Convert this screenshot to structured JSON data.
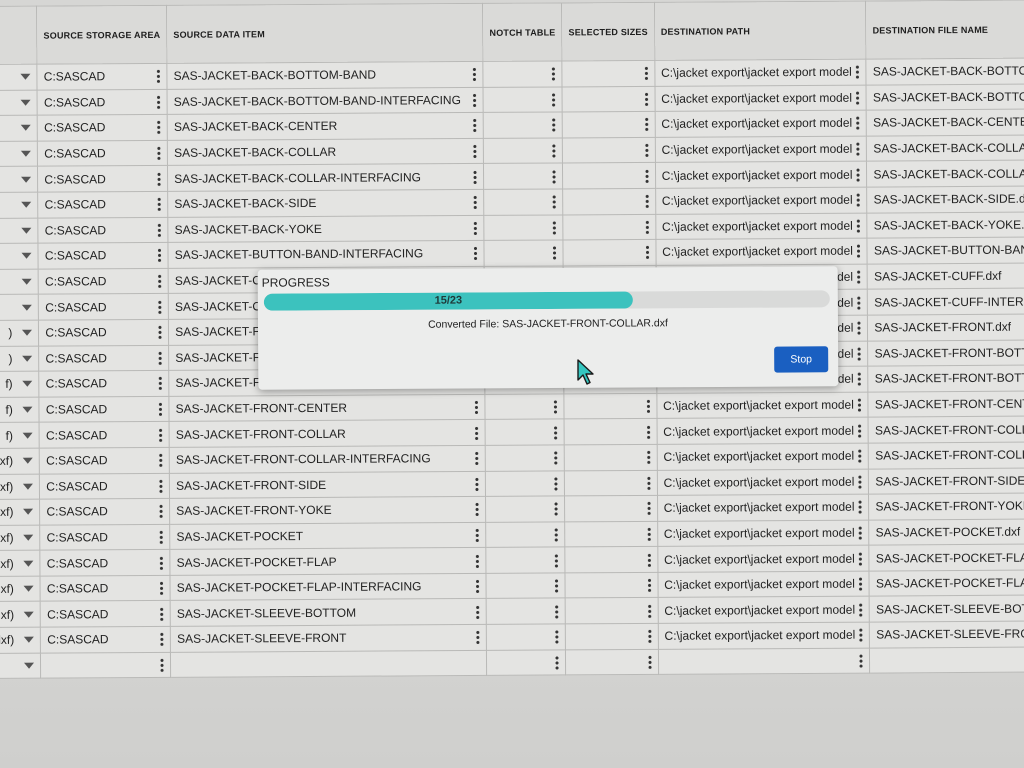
{
  "table": {
    "columns": {
      "expander": "",
      "source_storage_area": "SOURCE STORAGE AREA",
      "source_data_item": "SOURCE DATA ITEM",
      "notch_table": "NOTCH TABLE",
      "selected_sizes": "SELECTED SIZES",
      "destination_path": "DESTINATION PATH",
      "destination_file_name": "DESTINATION FILE NAME"
    },
    "rows": [
      {
        "exp": "",
        "src": "C:SASCAD",
        "item": "SAS-JACKET-BACK-BOTTOM-BAND",
        "path": "C:\\jacket export\\jacket export model",
        "file": "SAS-JACKET-BACK-BOTTOM-BAND.dxf"
      },
      {
        "exp": "",
        "src": "C:SASCAD",
        "item": "SAS-JACKET-BACK-BOTTOM-BAND-INTERFACING",
        "path": "C:\\jacket export\\jacket export model",
        "file": "SAS-JACKET-BACK-BOTTOM-BAND-INTERFACING.dxf"
      },
      {
        "exp": "",
        "src": "C:SASCAD",
        "item": "SAS-JACKET-BACK-CENTER",
        "path": "C:\\jacket export\\jacket export model",
        "file": "SAS-JACKET-BACK-CENTER.dxf"
      },
      {
        "exp": "",
        "src": "C:SASCAD",
        "item": "SAS-JACKET-BACK-COLLAR",
        "path": "C:\\jacket export\\jacket export model",
        "file": "SAS-JACKET-BACK-COLLAR.dxf"
      },
      {
        "exp": "",
        "src": "C:SASCAD",
        "item": "SAS-JACKET-BACK-COLLAR-INTERFACING",
        "path": "C:\\jacket export\\jacket export model",
        "file": "SAS-JACKET-BACK-COLLAR-INTERFACING.dxf"
      },
      {
        "exp": "",
        "src": "C:SASCAD",
        "item": "SAS-JACKET-BACK-SIDE",
        "path": "C:\\jacket export\\jacket export model",
        "file": "SAS-JACKET-BACK-SIDE.dxf"
      },
      {
        "exp": "",
        "src": "C:SASCAD",
        "item": "SAS-JACKET-BACK-YOKE",
        "path": "C:\\jacket export\\jacket export model",
        "file": "SAS-JACKET-BACK-YOKE.dxf"
      },
      {
        "exp": "",
        "src": "C:SASCAD",
        "item": "SAS-JACKET-BUTTON-BAND-INTERFACING",
        "path": "C:\\jacket export\\jacket export model",
        "file": "SAS-JACKET-BUTTON-BAND-INTERFACING.dxf"
      },
      {
        "exp": "",
        "src": "C:SASCAD",
        "item": "SAS-JACKET-CUFF",
        "path": "C:\\jacket export\\jacket export model",
        "file": "SAS-JACKET-CUFF.dxf"
      },
      {
        "exp": "",
        "src": "C:SASCAD",
        "item": "SAS-JACKET-CUFF-INTERFACING",
        "path": "C:\\jacket export\\jacket export model",
        "file": "SAS-JACKET-CUFF-INTERFACING.dxf"
      },
      {
        "exp": ")",
        "src": "C:SASCAD",
        "item": "SAS-JACKET-FRONT",
        "path": "C:\\jacket export\\jacket export model",
        "file": "SAS-JACKET-FRONT.dxf"
      },
      {
        "exp": ")",
        "src": "C:SASCAD",
        "item": "SAS-JACKET-FRONT-BOTTOM-BAND",
        "path": "C:\\jacket export\\jacket export model",
        "file": "SAS-JACKET-FRONT-BOTTOM-BAND.dxf"
      },
      {
        "exp": "f)",
        "src": "C:SASCAD",
        "item": "SAS-JACKET-FRONT-BOTTOM-BAND-INTERFACING",
        "path": "C:\\jacket export\\jacket export model",
        "file": "SAS-JACKET-FRONT-BOTTOM-BAND-INTERFACING.dxf"
      },
      {
        "exp": "f)",
        "src": "C:SASCAD",
        "item": "SAS-JACKET-FRONT-CENTER",
        "path": "C:\\jacket export\\jacket export model",
        "file": "SAS-JACKET-FRONT-CENTER.dxf"
      },
      {
        "exp": "f)",
        "src": "C:SASCAD",
        "item": "SAS-JACKET-FRONT-COLLAR",
        "path": "C:\\jacket export\\jacket export model",
        "file": "SAS-JACKET-FRONT-COLLAR.dxf"
      },
      {
        "exp": "xf)",
        "src": "C:SASCAD",
        "item": "SAS-JACKET-FRONT-COLLAR-INTERFACING",
        "path": "C:\\jacket export\\jacket export model",
        "file": "SAS-JACKET-FRONT-COLLAR-INTERFACING.dxf"
      },
      {
        "exp": "xf)",
        "src": "C:SASCAD",
        "item": "SAS-JACKET-FRONT-SIDE",
        "path": "C:\\jacket export\\jacket export model",
        "file": "SAS-JACKET-FRONT-SIDE.dxf"
      },
      {
        "exp": "xf)",
        "src": "C:SASCAD",
        "item": "SAS-JACKET-FRONT-YOKE",
        "path": "C:\\jacket export\\jacket export model",
        "file": "SAS-JACKET-FRONT-YOKE.dxf"
      },
      {
        "exp": "dxf)",
        "src": "C:SASCAD",
        "item": "SAS-JACKET-POCKET",
        "path": "C:\\jacket export\\jacket export model",
        "file": "SAS-JACKET-POCKET.dxf"
      },
      {
        "exp": "dxf)",
        "src": "C:SASCAD",
        "item": "SAS-JACKET-POCKET-FLAP",
        "path": "C:\\jacket export\\jacket export model",
        "file": "SAS-JACKET-POCKET-FLAP.dxf"
      },
      {
        "exp": "dxf)",
        "src": "C:SASCAD",
        "item": "SAS-JACKET-POCKET-FLAP-INTERFACING",
        "path": "C:\\jacket export\\jacket export model",
        "file": "SAS-JACKET-POCKET-FLAP-INTERFACING.dxf"
      },
      {
        "exp": ".dxf)",
        "src": "C:SASCAD",
        "item": "SAS-JACKET-SLEEVE-BOTTOM",
        "path": "C:\\jacket export\\jacket export model",
        "file": "SAS-JACKET-SLEEVE-BOTTOM.dxf"
      },
      {
        "exp": ".dxf)",
        "src": "C:SASCAD",
        "item": "SAS-JACKET-SLEEVE-FRONT",
        "path": "C:\\jacket export\\jacket export model",
        "file": "SAS-JACKET-SLEEVE-FRONT.dxf"
      },
      {
        "exp": "",
        "src": "",
        "item": "",
        "path": "",
        "file": ""
      }
    ]
  },
  "progress_dialog": {
    "title": "PROGRESS",
    "current": 15,
    "total": 23,
    "label": "15/23",
    "converted_prefix": "Converted File: ",
    "converted_file": "SAS-JACKET-FRONT-COLLAR.dxf",
    "stop_label": "Stop",
    "bar_color": "#3cc2be",
    "stop_color": "#1a5fc1"
  }
}
